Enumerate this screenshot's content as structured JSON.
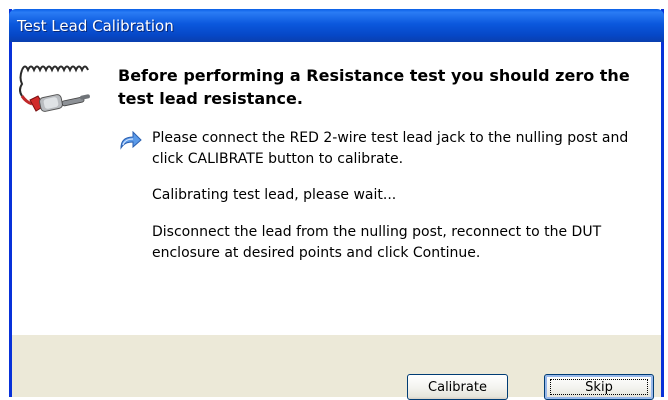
{
  "window": {
    "title": "Test Lead Calibration"
  },
  "content": {
    "heading": "Before performing a Resistance test you should zero the test lead resistance.",
    "step1": "Please connect the RED 2-wire test lead jack to the nulling post and click CALIBRATE button to calibrate.",
    "step2": "Calibrating test lead, please wait...",
    "step3": "Disconnect the lead from the nulling post, reconnect to the DUT enclosure at desired points and click Continue."
  },
  "buttons": {
    "calibrate_label": "Calibrate",
    "skip_label": "Skip"
  },
  "icons": {
    "lead": "test-lead-icon",
    "arrow": "arrow-icon"
  },
  "colors": {
    "titlebar": "#0b58dd",
    "footer": "#ece9d8",
    "arrow": "#3a78d6"
  }
}
